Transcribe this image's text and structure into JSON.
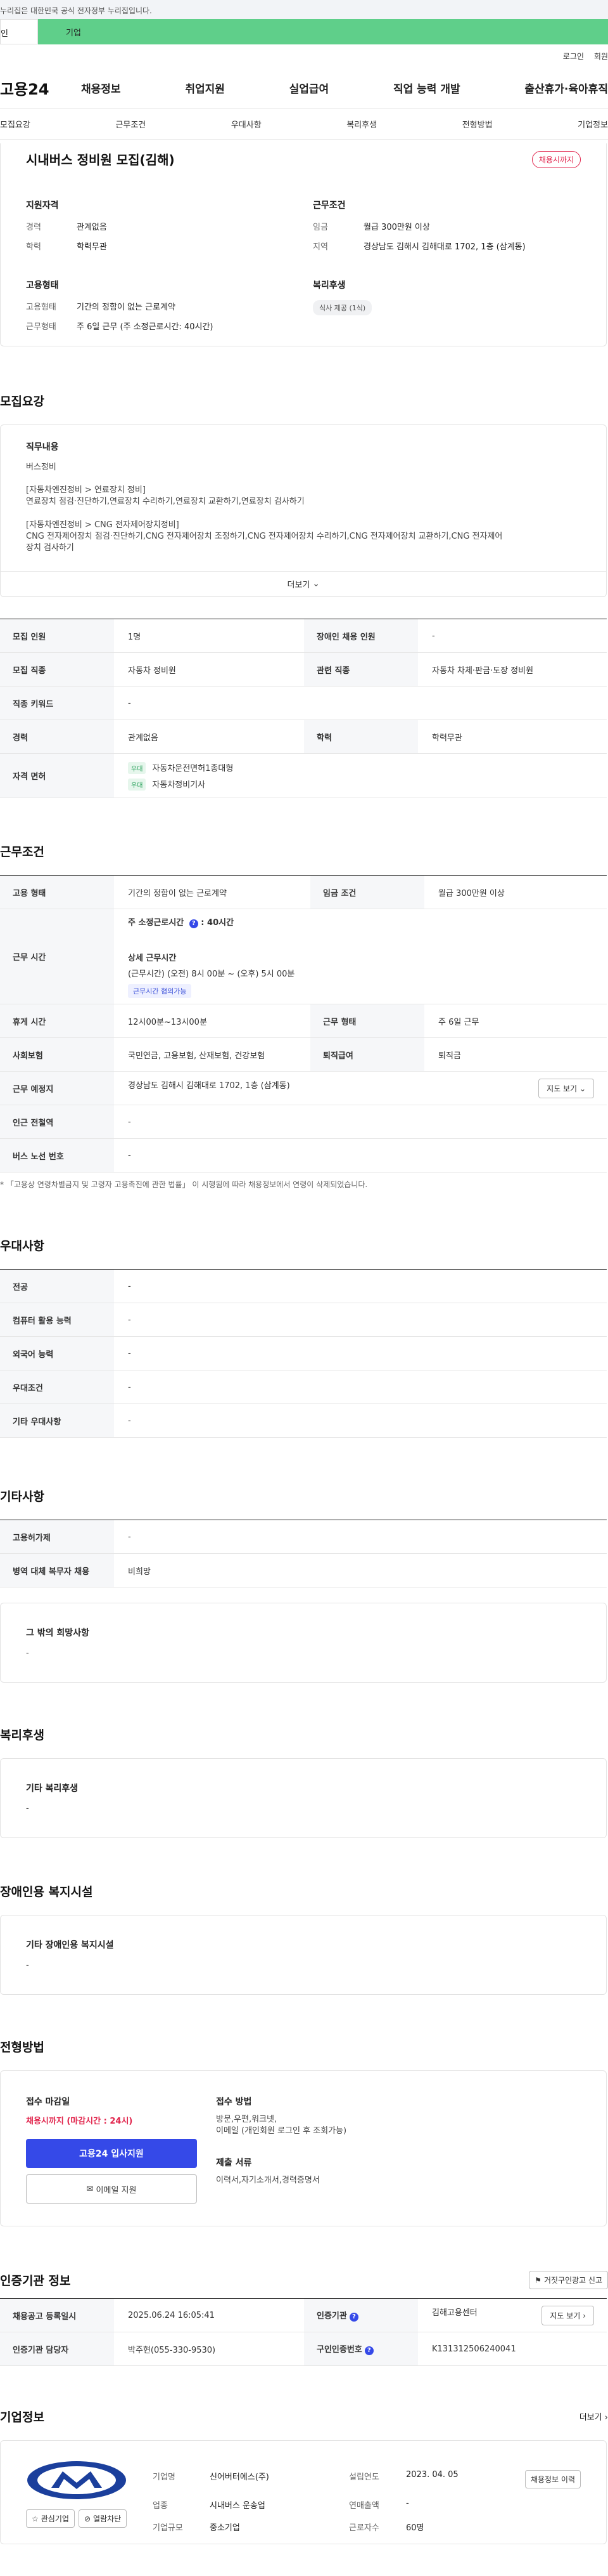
{
  "gov_notice": "누리집은 대한민국 공식 전자정부 누리집입니다.",
  "top_tabs": {
    "individual": "인",
    "business": "기업"
  },
  "util": {
    "login": "로그인",
    "signup": "회원"
  },
  "logo": "고용24",
  "gnb": [
    "채용정보",
    "취업지원",
    "실업급여",
    "직업 능력 개발",
    "출산휴가·육아휴직"
  ],
  "subnav": [
    "모집요강",
    "근무조건",
    "우대사항",
    "복리후생",
    "전형방법",
    "기업정보"
  ],
  "summary": {
    "title": "시내버스 정비원 모집(김해)",
    "status": "채용시까지",
    "qual_title": "지원자격",
    "qual_rows": [
      {
        "k": "경력",
        "v": "관계없음"
      },
      {
        "k": "학력",
        "v": "학력무관"
      }
    ],
    "cond_title": "근무조건",
    "cond_rows": [
      {
        "k": "임금",
        "v": "월급 300만원 이상"
      },
      {
        "k": "지역",
        "v": "경상남도 김해시 김해대로 1702, 1층 (삼계동)"
      }
    ],
    "emp_title": "고용형태",
    "emp_rows": [
      {
        "k": "고용형태",
        "v": "기간의 정함이 없는 근로계약"
      },
      {
        "k": "근무형태",
        "v": "주 6일 근무 (주 소정근로시간: 40시간)"
      }
    ],
    "welfare_title": "복리후생",
    "welfare_chip": "식사 제공 (1식)"
  },
  "recruit": {
    "title": "모집요강",
    "duty_title": "직무내용",
    "duty_lines": [
      "버스정비",
      "[자동차엔진정비 > 연료장치 정비]",
      "연료장치 점검·진단하기,연료장치 수리하기,연료장치 교환하기,연료장치 검사하기",
      "[자동차엔진정비 > CNG 전자제어장치정비]",
      "CNG 전자제어장치 점검·진단하기,CNG 전자제어장치 조정하기,CNG 전자제어장치 수리하기,CNG 전자제어장치 교환하기,CNG 전자제어",
      "장치 검사하기"
    ],
    "more": "더보기",
    "rows": {
      "count_k": "모집 인원",
      "count_v": "1명",
      "disabled_k": "장애인 채용 인원",
      "disabled_v": "-",
      "job_k": "모집 직종",
      "job_v": "자동차 정비원",
      "related_k": "관련 직종",
      "related_v": "자동차 차체·판금·도장 정비원",
      "keyword_k": "직종 키워드",
      "keyword_v": "-",
      "career_k": "경력",
      "career_v": "관계없음",
      "edu_k": "학력",
      "edu_v": "학력무관",
      "license_k": "자격 면허",
      "licenses": [
        {
          "tag": "우대",
          "name": "자동차운전면허1종대형"
        },
        {
          "tag": "우대",
          "name": "자동차정비기사"
        }
      ]
    }
  },
  "conditions": {
    "title": "근무조건",
    "emp_k": "고용 형태",
    "emp_v": "기간의 정함이 없는 근로계약",
    "wage_k": "임금 조건",
    "wage_v": "월급 300만원 이상",
    "hours_k": "근무 시간",
    "hours_main_label": "주 소정근로시간",
    "hours_main_value": "40시간",
    "hours_detail_title": "상세 근무시간",
    "hours_detail": "(근무시간) (오전) 8시 00분 ~ (오후) 5시 00분",
    "hours_chip": "근무시간 협의가능",
    "break_k": "휴게 시간",
    "break_v": "12시00분~13시00분",
    "worktype_k": "근무 형태",
    "worktype_v": "주 6일 근무",
    "insurance_k": "사회보험",
    "insurance_v": "국민연금, 고용보험, 산재보험, 건강보험",
    "severance_k": "퇴직급여",
    "severance_v": "퇴직금",
    "location_k": "근무 예정지",
    "location_v": "경상남도 김해시 김해대로 1702, 1층 (삼계동)",
    "map_btn": "지도 보기",
    "subway_k": "인근 전철역",
    "subway_v": "-",
    "bus_k": "버스 노선 번호",
    "bus_v": "-",
    "footnote": "* 「고용상 연령차별금지 및 고령자 고용촉진에 관한 법률」 이 시행됨에 따라 채용정보에서 연령이 삭제되었습니다."
  },
  "preference": {
    "title": "우대사항",
    "rows": [
      {
        "k": "전공",
        "v": "-"
      },
      {
        "k": "컴퓨터 활용 능력",
        "v": "-"
      },
      {
        "k": "외국어 능력",
        "v": "-"
      },
      {
        "k": "우대조건",
        "v": "-"
      },
      {
        "k": "기타 우대사항",
        "v": "-"
      }
    ]
  },
  "etc": {
    "title": "기타사항",
    "rows": [
      {
        "k": "고용허가제",
        "v": "-"
      },
      {
        "k": "병역 대체 복무자 채용",
        "v": "비희망"
      }
    ],
    "other_title": "그 밖의 희망사항",
    "other_value": "-"
  },
  "welfare": {
    "title": "복리후생",
    "sub": "기타 복리후생",
    "value": "-"
  },
  "disabled_facility": {
    "title": "장애인용 복지시설",
    "sub": "기타 장애인용 복지시설",
    "value": "-"
  },
  "apply": {
    "title": "전형방법",
    "deadline_title": "접수 마감일",
    "deadline_value": "채용시까지 (마감시간 : 24시)",
    "apply_btn": "고용24 입사지원",
    "email_btn": "이메일 지원",
    "method_title": "접수 방법",
    "method_value1": "방문,우편,워크넷,",
    "method_value2": "이메일 (개인회원 로그인 후 조회가능)",
    "docs_title": "제출 서류",
    "docs_value": "이력서,자기소개서,경력증명서"
  },
  "agency": {
    "title": "인증기관 정보",
    "report_btn": "거짓구인광고 신고",
    "reg_k": "채용공고 등록일시",
    "reg_v": "2025.06.24 16:05:41",
    "org_k": "인증기관",
    "org_v": "김해고용센터",
    "map_btn": "지도 보기",
    "staff_k": "인증기관 담당자",
    "staff_v": "박주현(055-330-9530)",
    "id_k": "구인인증번호",
    "id_v": "K131312506240041"
  },
  "company": {
    "title": "기업정보",
    "more": "더보기",
    "name_k": "기업명",
    "name_v": "신어버터에스(주)",
    "founded_k": "설립연도",
    "founded_v": "2023. 04. 05",
    "industry_k": "업종",
    "industry_v": "시내버스 운송업",
    "sales_k": "연매출액",
    "sales_v": "-",
    "size_k": "기업규모",
    "size_v": "중소기업",
    "staff_k": "근로자수",
    "staff_v": "60명",
    "jobs_btn": "채용정보 이력",
    "fav_btn": "관심기업",
    "block_btn": "열람차단"
  },
  "colors": {
    "accent": "#3549e8",
    "danger": "#e1234b",
    "green": "#5fcf8a"
  }
}
